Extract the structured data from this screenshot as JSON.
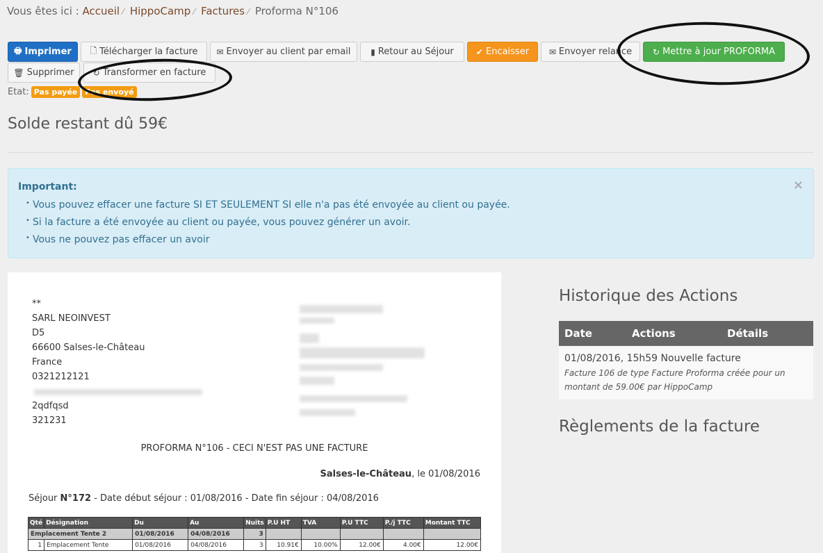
{
  "breadcrumb": {
    "prefix": "Vous êtes ici :",
    "items": [
      "Accueil",
      "HippoCamp",
      "Factures",
      "Proforma N°106"
    ]
  },
  "toolbar": {
    "print": "Imprimer",
    "download": "Télécharger la facture",
    "email": "Envoyer au client par email",
    "back": "Retour au Séjour",
    "cash": "Encaisser",
    "reminder": "Envoyer relance",
    "update": "Mettre à jour PROFORMA",
    "delete": "Supprimer",
    "transform": "Transformer en facture"
  },
  "etat": {
    "label": "Etat:",
    "badges": [
      "Pas payée",
      "Pas envoyé"
    ]
  },
  "solde": "Solde restant dû 59€",
  "alert": {
    "title": "Important:",
    "items": [
      "Vous pouvez effacer une facture SI ET SEULEMENT SI elle n'a pas été envoyée au client ou payée.",
      "Si la facture a été envoyée au client ou payée, vous pouvez générer un avoir.",
      "Vous ne pouvez pas effacer un avoir"
    ],
    "close": "×"
  },
  "document": {
    "client_lines": [
      "**",
      "SARL NEOINVEST",
      "D5",
      "66600 Salses-le-Château",
      "France",
      "0321212121",
      "",
      "2qdfqsd",
      "321231"
    ],
    "title": "PROFORMA N°106 - CECI N'EST PAS UNE FACTURE",
    "place_bold": "Salses-le-Château",
    "place_rest": ", le 01/08/2016",
    "sejour_prefix": "Séjour ",
    "sejour_num": "N°172",
    "sejour_rest": " - Date début séjour : 01/08/2016 - Date fin séjour : 04/08/2016",
    "table": {
      "headers": [
        "Qté",
        "Désignation",
        "Du",
        "Au",
        "Nuits",
        "P.U HT",
        "TVA",
        "P.U TTC",
        "P./j TTC",
        "Montant TTC"
      ],
      "group": {
        "name": "Emplacement Tente 2",
        "du": "01/08/2016",
        "au": "04/08/2016",
        "nuits": "3"
      },
      "row": {
        "qte": "1",
        "designation": "Emplacement Tente",
        "du": "01/08/2016",
        "au": "04/08/2016",
        "nuits": "3",
        "pu_ht": "10.91€",
        "tva": "10.00%",
        "pu_ttc": "12.00€",
        "pj_ttc": "4.00€",
        "montant": "12.00€"
      }
    }
  },
  "history": {
    "title": "Historique des Actions",
    "headers": [
      "Date",
      "Actions",
      "Détails"
    ],
    "entry_main": "01/08/2016, 15h59 Nouvelle facture",
    "entry_detail": "Facture 106 de type Facture Proforma créée pour un montant de 59.00€ par HippoCamp"
  },
  "reglements_title": "Règlements de la facture",
  "colors": {
    "primary": "#1f6fc5",
    "warning": "#f5951d",
    "success": "#4cae4c",
    "info_bg": "#d9edf7"
  }
}
